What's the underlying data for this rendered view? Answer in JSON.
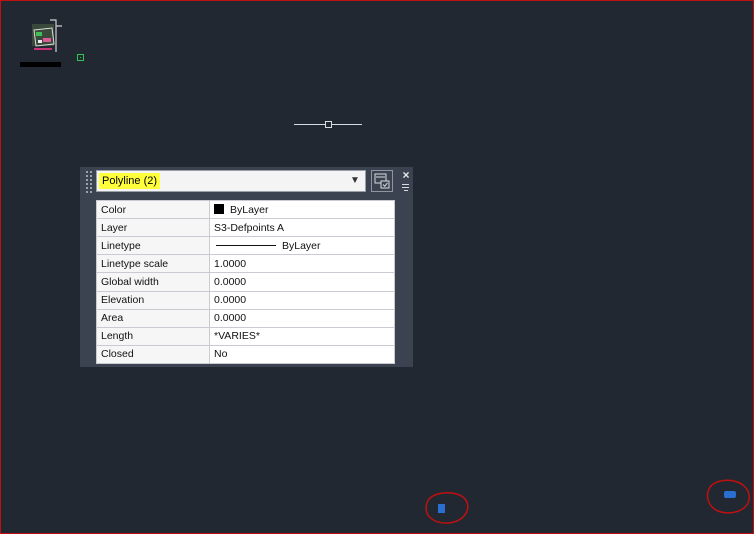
{
  "palette": {
    "selection": "Polyline (2)",
    "rows": [
      {
        "key": "Color",
        "value": "ByLayer",
        "swatch": "#000000"
      },
      {
        "key": "Layer",
        "value": "S3-Defpoints A"
      },
      {
        "key": "Linetype",
        "value": "ByLayer"
      },
      {
        "key": "Linetype scale",
        "value": "1.0000"
      },
      {
        "key": "Global width",
        "value": "0.0000"
      },
      {
        "key": "Elevation",
        "value": "0.0000"
      },
      {
        "key": "Area",
        "value": "0.0000"
      },
      {
        "key": "Length",
        "value": "*VARIES*"
      },
      {
        "key": "Closed",
        "value": "No"
      }
    ],
    "close_glyph": "×"
  },
  "icons": {
    "dropdown": "chevron-down-icon",
    "quick_select": "quick-select-icon",
    "close": "close-icon",
    "options": "palette-menu-icon"
  },
  "colors": {
    "canvas": "#222831",
    "highlight": "#ffff3c",
    "annotation": "#c01010",
    "marker": "#2a6fcf"
  }
}
